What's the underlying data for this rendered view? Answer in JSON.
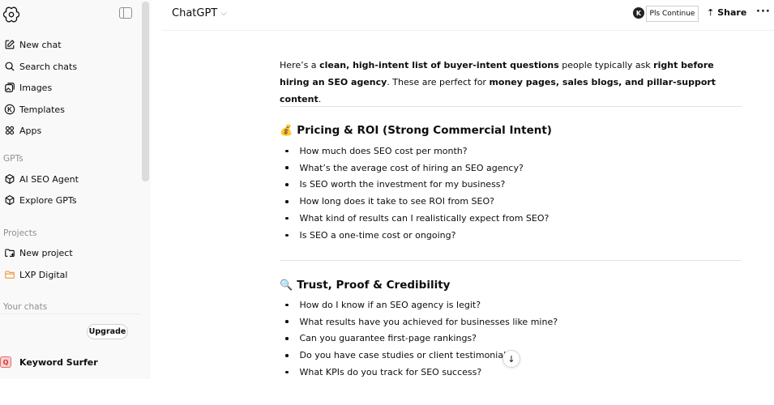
{
  "sidebar": {
    "items": [
      {
        "label": "New chat",
        "icon": "pencil-square-icon"
      },
      {
        "label": "Search chats",
        "icon": "search-icon"
      },
      {
        "label": "Images",
        "icon": "images-icon"
      },
      {
        "label": "Templates",
        "icon": "k-circle-icon"
      },
      {
        "label": "Apps",
        "icon": "apps-grid-icon"
      }
    ],
    "gpts_label": "GPTs",
    "gpts": [
      {
        "label": "AI SEO Agent",
        "icon": "cube-icon"
      },
      {
        "label": "Explore GPTs",
        "icon": "cube-icon"
      }
    ],
    "projects_label": "Projects",
    "projects": [
      {
        "label": "New project",
        "icon": "folder-plus-icon"
      },
      {
        "label": "LXP Digital",
        "icon": "folder-icon",
        "color": "#f0a04b"
      }
    ],
    "your_chats_label": "Your chats",
    "upgrade_label": "Upgrade",
    "keyword_surfer_label": "Keyword Surfer"
  },
  "header": {
    "model_name": "ChatGPT",
    "pls_continue": "Pls Continue",
    "share_label": "Share",
    "more": "···"
  },
  "main": {
    "intro": {
      "p1": "Here’s a ",
      "b1": "clean, high-intent list of buyer-intent questions",
      "p2": " people typically ask ",
      "b2": "right before hiring an SEO agency",
      "p3": ". These are perfect for ",
      "b3": "money pages, sales blogs, and pillar-support content",
      "p4": "."
    },
    "sections": [
      {
        "emoji": "💰",
        "title": "Pricing & ROI (Strong Commercial Intent)",
        "items": [
          "How much does SEO cost per month?",
          "What’s the average cost of hiring an SEO agency?",
          "Is SEO worth the investment for my business?",
          "How long does it take to see ROI from SEO?",
          "What kind of results can I realistically expect from SEO?",
          "Is SEO a one-time cost or ongoing?"
        ]
      },
      {
        "emoji": "🔍",
        "title": "Trust, Proof & Credibility",
        "items": [
          "How do I know if an SEO agency is legit?",
          "What results have you achieved for businesses like mine?",
          "Can you guarantee first-page rankings?",
          "Do you have case studies or client testimonials?",
          "What KPIs do you track for SEO success?"
        ]
      }
    ]
  },
  "colors": {
    "sidebar_bg": "#f9f9f9",
    "text": "#0d0d0d",
    "muted": "#8f8f8f",
    "folder_accent": "#f0a04b"
  }
}
